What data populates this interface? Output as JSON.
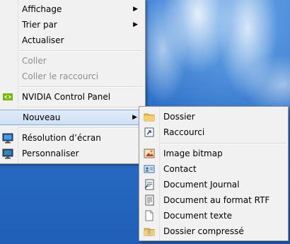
{
  "context_menu": {
    "items": [
      {
        "label": "Affichage"
      },
      {
        "label": "Trier par"
      },
      {
        "label": "Actualiser"
      },
      {
        "label": "Coller"
      },
      {
        "label": "Coller le raccourci"
      },
      {
        "label": "NVIDIA Control Panel",
        "icon": "nvidia-icon"
      },
      {
        "label": "Nouveau"
      },
      {
        "label": "Résolution d’écran",
        "icon": "display-icon"
      },
      {
        "label": "Personnaliser",
        "icon": "personalize-icon"
      }
    ]
  },
  "submenu": {
    "items": [
      {
        "label": "Dossier",
        "icon": "folder-icon"
      },
      {
        "label": "Raccourci",
        "icon": "shortcut-icon"
      },
      {
        "label": "Image bitmap",
        "icon": "bitmap-icon"
      },
      {
        "label": "Contact",
        "icon": "contact-icon"
      },
      {
        "label": "Document Journal",
        "icon": "journal-icon"
      },
      {
        "label": "Document au format RTF",
        "icon": "rtf-icon"
      },
      {
        "label": "Document texte",
        "icon": "text-document-icon"
      },
      {
        "label": "Dossier compressé",
        "icon": "zip-folder-icon"
      }
    ]
  },
  "colors": {
    "menu_bg": "#f1f1f1",
    "highlight_border": "#84acdd",
    "disabled_text": "#8d8d8d"
  }
}
